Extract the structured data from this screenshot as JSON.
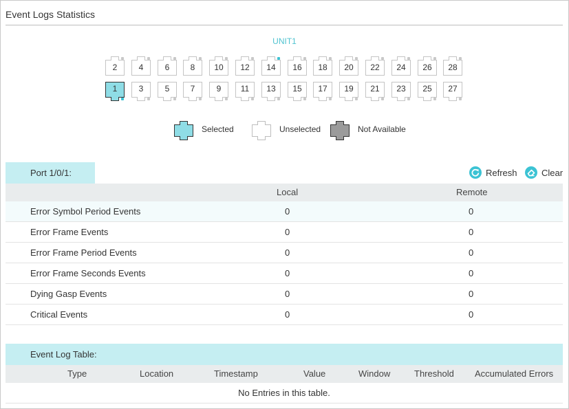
{
  "page": {
    "title": "Event Logs Statistics"
  },
  "unit": {
    "label": "UNIT1"
  },
  "ports": {
    "top_row": [
      "2",
      "4",
      "6",
      "8",
      "10",
      "12",
      "14",
      "16",
      "18",
      "20",
      "22",
      "24",
      "26",
      "28"
    ],
    "bottom_row": [
      "1",
      "3",
      "5",
      "7",
      "9",
      "11",
      "13",
      "15",
      "17",
      "19",
      "21",
      "23",
      "25",
      "27"
    ],
    "selected": "1",
    "link_up": [
      "1",
      "14"
    ]
  },
  "legend": {
    "selected": "Selected",
    "unselected": "Unselected",
    "not_available": "Not Available"
  },
  "colors": {
    "accent": "#3cc3d4",
    "selected_fill": "#8fdde6",
    "not_available_fill": "#9b9b9b",
    "tab_bg": "#c5eef2",
    "header_bg": "#e9eced"
  },
  "port_panel": {
    "tab_label": "Port 1/0/1:",
    "refresh_label": "Refresh",
    "clear_label": "Clear",
    "refresh_icon": "refresh-icon",
    "clear_icon": "eraser-icon",
    "columns": {
      "local": "Local",
      "remote": "Remote"
    },
    "rows": [
      {
        "label": "Error Symbol Period Events",
        "local": "0",
        "remote": "0"
      },
      {
        "label": "Error Frame Events",
        "local": "0",
        "remote": "0"
      },
      {
        "label": "Error Frame Period Events",
        "local": "0",
        "remote": "0"
      },
      {
        "label": "Error Frame Seconds Events",
        "local": "0",
        "remote": "0"
      },
      {
        "label": "Dying Gasp Events",
        "local": "0",
        "remote": "0"
      },
      {
        "label": "Critical Events",
        "local": "0",
        "remote": "0"
      }
    ]
  },
  "event_log_table": {
    "tab_label": "Event Log Table:",
    "columns": [
      "Type",
      "Location",
      "Timestamp",
      "Value",
      "Window",
      "Threshold",
      "Accumulated Errors"
    ],
    "empty_message": "No Entries in this table."
  }
}
